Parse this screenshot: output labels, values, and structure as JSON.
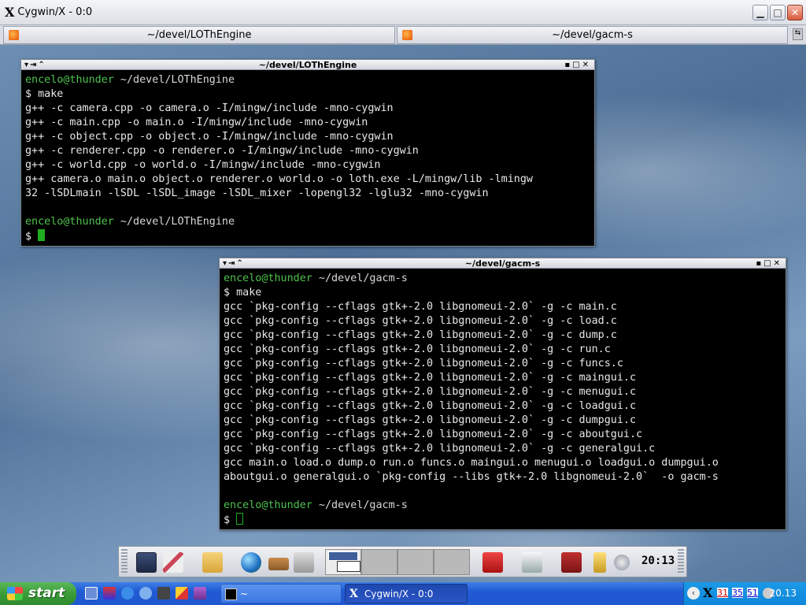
{
  "x_window": {
    "title": "Cygwin/X - 0:0",
    "logo_glyph": "X",
    "controls": [
      "minimize",
      "maximize",
      "close"
    ]
  },
  "wm_tabs": [
    {
      "label": "~/devel/LOThEngine"
    },
    {
      "label": "~/devel/gacm-s"
    }
  ],
  "terminals": [
    {
      "title": "~/devel/LOThEngine",
      "lines": [
        {
          "user": "encelo@thunder",
          "path": " ~/devel/LOThEngine"
        },
        {
          "text": "$ make"
        },
        {
          "text": "g++ -c camera.cpp -o camera.o -I/mingw/include -mno-cygwin"
        },
        {
          "text": "g++ -c main.cpp -o main.o -I/mingw/include -mno-cygwin"
        },
        {
          "text": "g++ -c object.cpp -o object.o -I/mingw/include -mno-cygwin"
        },
        {
          "text": "g++ -c renderer.cpp -o renderer.o -I/mingw/include -mno-cygwin"
        },
        {
          "text": "g++ -c world.cpp -o world.o -I/mingw/include -mno-cygwin"
        },
        {
          "text": "g++ camera.o main.o object.o renderer.o world.o -o loth.exe -L/mingw/lib -lmingw"
        },
        {
          "text": "32 -lSDLmain -lSDL -lSDL_image -lSDL_mixer -lopengl32 -lglu32 -mno-cygwin"
        },
        {
          "text": ""
        },
        {
          "user": "encelo@thunder",
          "path": " ~/devel/LOThEngine"
        },
        {
          "text": "$ "
        }
      ]
    },
    {
      "title": "~/devel/gacm-s",
      "lines": [
        {
          "user": "encelo@thunder",
          "path": " ~/devel/gacm-s"
        },
        {
          "text": "$ make"
        },
        {
          "text": "gcc `pkg-config --cflags gtk+-2.0 libgnomeui-2.0` -g -c main.c"
        },
        {
          "text": "gcc `pkg-config --cflags gtk+-2.0 libgnomeui-2.0` -g -c load.c"
        },
        {
          "text": "gcc `pkg-config --cflags gtk+-2.0 libgnomeui-2.0` -g -c dump.c"
        },
        {
          "text": "gcc `pkg-config --cflags gtk+-2.0 libgnomeui-2.0` -g -c run.c"
        },
        {
          "text": "gcc `pkg-config --cflags gtk+-2.0 libgnomeui-2.0` -g -c funcs.c"
        },
        {
          "text": "gcc `pkg-config --cflags gtk+-2.0 libgnomeui-2.0` -g -c maingui.c"
        },
        {
          "text": "gcc `pkg-config --cflags gtk+-2.0 libgnomeui-2.0` -g -c menugui.c"
        },
        {
          "text": "gcc `pkg-config --cflags gtk+-2.0 libgnomeui-2.0` -g -c loadgui.c"
        },
        {
          "text": "gcc `pkg-config --cflags gtk+-2.0 libgnomeui-2.0` -g -c dumpgui.c"
        },
        {
          "text": "gcc `pkg-config --cflags gtk+-2.0 libgnomeui-2.0` -g -c aboutgui.c"
        },
        {
          "text": "gcc `pkg-config --cflags gtk+-2.0 libgnomeui-2.0` -g -c generalgui.c"
        },
        {
          "text": "gcc main.o load.o dump.o run.o funcs.o maingui.o menugui.o loadgui.o dumpgui.o"
        },
        {
          "text": "aboutgui.o generalgui.o `pkg-config --libs gtk+-2.0 libgnomeui-2.0`  -o gacm-s"
        },
        {
          "text": ""
        },
        {
          "user": "encelo@thunder",
          "path": " ~/devel/gacm-s"
        },
        {
          "text": "$ "
        }
      ]
    }
  ],
  "panel": {
    "clock": "20:13",
    "icons": [
      "terminal-icon",
      "text-editor-icon",
      "folder-icon",
      "web-browser-icon",
      "package-icon",
      "image-viewer-icon",
      "toolbox-icon",
      "printer-icon",
      "book-icon",
      "lock-icon",
      "power-icon"
    ]
  },
  "taskbar": {
    "start_label": "start",
    "tasks": [
      {
        "label": "~"
      },
      {
        "label": "Cygwin/X - 0:0"
      }
    ],
    "tray_time": "20.13",
    "tray_icons": [
      "X",
      "31",
      "35",
      "51"
    ]
  },
  "colors": {
    "prompt_user": "#4ec24e",
    "terminal_bg": "#000000",
    "cursor": "#1fae1f",
    "taskbar": "#2157cf",
    "start_green": "#3a9c38"
  }
}
